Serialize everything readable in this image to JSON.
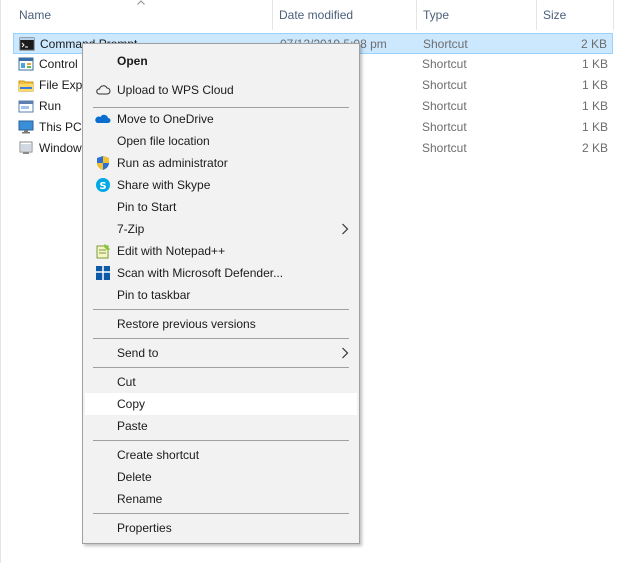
{
  "columns": {
    "name": "Name",
    "date_modified": "Date modified",
    "type": "Type",
    "size": "Size"
  },
  "files": [
    {
      "name": "Command Prompt",
      "date": "07/12/2019 5:08 pm",
      "type": "Shortcut",
      "size": "2 KB",
      "icon": "command-prompt-icon",
      "selected": true
    },
    {
      "name": "Control",
      "date": "pm",
      "type": "Shortcut",
      "size": "1 KB",
      "icon": "control-panel-icon"
    },
    {
      "name": "File Expl",
      "date": "pm",
      "type": "Shortcut",
      "size": "1 KB",
      "icon": "file-explorer-icon"
    },
    {
      "name": "Run",
      "date": "pm",
      "type": "Shortcut",
      "size": "1 KB",
      "icon": "run-icon"
    },
    {
      "name": "This PC",
      "date": "pm",
      "type": "Shortcut",
      "size": "1 KB",
      "icon": "this-pc-icon"
    },
    {
      "name": "Window",
      "date": "pm",
      "type": "Shortcut",
      "size": "2 KB",
      "icon": "windows-icon"
    }
  ],
  "context_menu": {
    "open": "Open",
    "upload_wps": "Upload to WPS Cloud",
    "move_onedrive": "Move to OneDrive",
    "open_file_location": "Open file location",
    "run_as_admin": "Run as administrator",
    "share_skype": "Share with Skype",
    "pin_start": "Pin to Start",
    "seven_zip": "7-Zip",
    "edit_notepad": "Edit with Notepad++",
    "scan_defender": "Scan with Microsoft Defender...",
    "pin_taskbar": "Pin to taskbar",
    "restore_versions": "Restore previous versions",
    "send_to": "Send to",
    "cut": "Cut",
    "copy": "Copy",
    "paste": "Paste",
    "create_shortcut": "Create shortcut",
    "delete": "Delete",
    "rename": "Rename",
    "properties": "Properties"
  },
  "colors": {
    "selection": "#cce8ff",
    "menu_bg": "#f2f2f2",
    "header_text": "#4c607a"
  }
}
